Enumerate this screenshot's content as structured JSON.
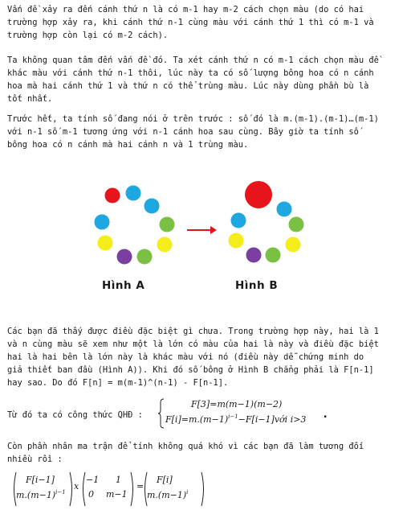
{
  "paragraphs": {
    "p1": [
      "Vấn đề xảy ra đến cánh thứ n là có m-1 hay m-2 cách chọn màu (do có hai",
      "trường hợp xảy ra, khi cánh thứ n-1 cùng màu với cánh thứ 1 thì có m-1 và",
      "trường hợp còn lại có m-2 cách)."
    ],
    "p2": [
      "Ta không quan tâm đến vấn đề đó. Ta xét cánh thứ n có m-1 cách chọn màu đề",
      "khác màu với cánh thứ n-1 thôi, lúc này ta có số lượng bông hoa có n cánh",
      "hoa mà hai cánh thứ 1 và thứ n có thể trùng màu. Lúc này dùng phần bù là",
      "tốt nhất."
    ],
    "p3": [
      "Trước hết, ta tính số đang nói ở trên trước : số đó là m.(m-1).(m-1)…(m-1)",
      "với n-1 số m-1 tương ứng với n-1 cánh hoa sau cùng. Bây giờ ta tính số",
      "bông hoa có n cánh mà hai cánh n và 1 trùng màu."
    ],
    "p4": [
      "Các bạn đã thấy được điều đặc biệt gì chưa. Trong trường hợp này, hai là 1",
      "và n cùng màu sẽ xem như một là lớn có màu của hai là này và điều đặc biệt",
      "hai là hai bên là lớn này là khác màu với nó (điều này dễ chứng minh do",
      "giả thiết ban đầu (Hình A)). Khi đó số bông ở Hình B chẳng phải là F[n-1]",
      "hay sao. Do đó F[n] = m(m-1)^(n-1) - F[n-1]."
    ],
    "p5": [
      "Từ đó ta có công thức QHĐ :"
    ],
    "p6": [
      "Còn phần nhân ma trận để tính không quá khó vì các bạn đã làm tương đối",
      "nhiều rồi :"
    ]
  },
  "figure": {
    "caption_a": "Hình A",
    "caption_b": "Hình B",
    "colors": {
      "red": "#e8141c",
      "blue": "#1ea7e0",
      "green": "#7ac043",
      "yellow": "#f5ed1a",
      "purple": "#7a3fa0",
      "arrow": "#e0141c"
    }
  },
  "recurrence": {
    "row1_lhs": "F[3]",
    "row1_eq": "=",
    "row1_rhs": "m(m−1)(m−2)",
    "row2_lhs": "F[i]",
    "row2_eq": "=",
    "row2_rhs_a": "m.(m−1)",
    "row2_exp": "i−1",
    "row2_rhs_b": "−F[i−1]",
    "row2_cond": "với i>3",
    "tail": "."
  },
  "matrix_eq": {
    "v1_top": "F[i−1]",
    "v1_bot_a": "m.(m−1)",
    "v1_bot_exp": "i−1",
    "times": "x",
    "m_a": "−1",
    "m_b": "1",
    "m_c": "0",
    "m_d": "m−1",
    "eq": "=",
    "v2_top": "F[i]",
    "v2_bot_a": "m.(m−1)",
    "v2_bot_exp": "i"
  }
}
